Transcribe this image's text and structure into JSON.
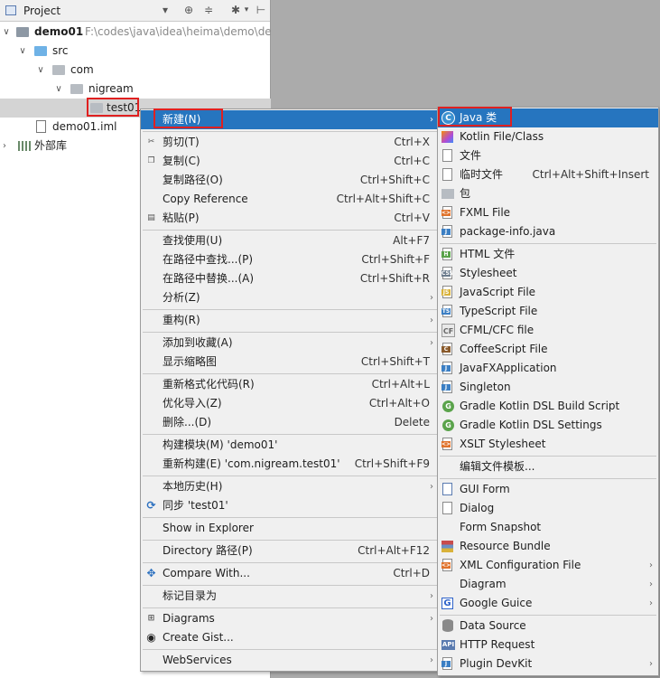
{
  "project_panel": {
    "title": "Project",
    "tree": [
      {
        "label": "demo01",
        "path": "F:\\codes\\java\\idea\\heima\\demo\\de"
      },
      {
        "label": "src"
      },
      {
        "label": "com"
      },
      {
        "label": "nigream"
      },
      {
        "label": "test01"
      },
      {
        "label": "demo01.iml"
      },
      {
        "label": "外部库"
      }
    ]
  },
  "context_menu": {
    "items": [
      {
        "label": "新建(N)",
        "shortcut": ""
      },
      {
        "label": "剪切(T)",
        "shortcut": "Ctrl+X"
      },
      {
        "label": "复制(C)",
        "shortcut": "Ctrl+C"
      },
      {
        "label": "复制路径(O)",
        "shortcut": "Ctrl+Shift+C"
      },
      {
        "label": "Copy Reference",
        "shortcut": "Ctrl+Alt+Shift+C"
      },
      {
        "label": "粘贴(P)",
        "shortcut": "Ctrl+V"
      },
      {
        "label": "查找使用(U)",
        "shortcut": "Alt+F7"
      },
      {
        "label": "在路径中查找...(P)",
        "shortcut": "Ctrl+Shift+F"
      },
      {
        "label": "在路径中替换...(A)",
        "shortcut": "Ctrl+Shift+R"
      },
      {
        "label": "分析(Z)",
        "shortcut": ""
      },
      {
        "label": "重构(R)",
        "shortcut": ""
      },
      {
        "label": "添加到收藏(A)",
        "shortcut": ""
      },
      {
        "label": "显示缩略图",
        "shortcut": "Ctrl+Shift+T"
      },
      {
        "label": "重新格式化代码(R)",
        "shortcut": "Ctrl+Alt+L"
      },
      {
        "label": "优化导入(Z)",
        "shortcut": "Ctrl+Alt+O"
      },
      {
        "label": "删除...(D)",
        "shortcut": "Delete"
      },
      {
        "label": "构建模块(M) 'demo01'",
        "shortcut": ""
      },
      {
        "label": "重新构建(E) 'com.nigream.test01'",
        "shortcut": "Ctrl+Shift+F9"
      },
      {
        "label": "本地历史(H)",
        "shortcut": ""
      },
      {
        "label": "同步 'test01'",
        "shortcut": ""
      },
      {
        "label": "Show in Explorer",
        "shortcut": ""
      },
      {
        "label": "Directory 路径(P)",
        "shortcut": "Ctrl+Alt+F12"
      },
      {
        "label": "Compare With...",
        "shortcut": "Ctrl+D"
      },
      {
        "label": "标记目录为",
        "shortcut": ""
      },
      {
        "label": "Diagrams",
        "shortcut": ""
      },
      {
        "label": "Create Gist...",
        "shortcut": ""
      },
      {
        "label": "WebServices",
        "shortcut": ""
      }
    ]
  },
  "new_submenu": {
    "items": [
      {
        "label": "Java 类",
        "shortcut": ""
      },
      {
        "label": "Kotlin File/Class",
        "shortcut": ""
      },
      {
        "label": "文件",
        "shortcut": ""
      },
      {
        "label": "临时文件",
        "shortcut": "Ctrl+Alt+Shift+Insert"
      },
      {
        "label": "包",
        "shortcut": ""
      },
      {
        "label": "FXML File",
        "shortcut": ""
      },
      {
        "label": "package-info.java",
        "shortcut": ""
      },
      {
        "label": "HTML 文件",
        "shortcut": ""
      },
      {
        "label": "Stylesheet",
        "shortcut": ""
      },
      {
        "label": "JavaScript File",
        "shortcut": ""
      },
      {
        "label": "TypeScript File",
        "shortcut": ""
      },
      {
        "label": "CFML/CFC file",
        "shortcut": ""
      },
      {
        "label": "CoffeeScript File",
        "shortcut": ""
      },
      {
        "label": "JavaFXApplication",
        "shortcut": ""
      },
      {
        "label": "Singleton",
        "shortcut": ""
      },
      {
        "label": "Gradle Kotlin DSL Build Script",
        "shortcut": ""
      },
      {
        "label": "Gradle Kotlin DSL Settings",
        "shortcut": ""
      },
      {
        "label": "XSLT Stylesheet",
        "shortcut": ""
      },
      {
        "label": "编辑文件模板...",
        "shortcut": ""
      },
      {
        "label": "GUI Form",
        "shortcut": ""
      },
      {
        "label": "Dialog",
        "shortcut": ""
      },
      {
        "label": "Form Snapshot",
        "shortcut": ""
      },
      {
        "label": "Resource Bundle",
        "shortcut": ""
      },
      {
        "label": "XML Configuration File",
        "shortcut": ""
      },
      {
        "label": "Diagram",
        "shortcut": ""
      },
      {
        "label": "Google Guice",
        "shortcut": ""
      },
      {
        "label": "Data Source",
        "shortcut": ""
      },
      {
        "label": "HTTP Request",
        "shortcut": ""
      },
      {
        "label": "Plugin DevKit",
        "shortcut": ""
      }
    ]
  },
  "colors": {
    "highlight": "#2675bf",
    "annotation_box": "#e02020"
  }
}
